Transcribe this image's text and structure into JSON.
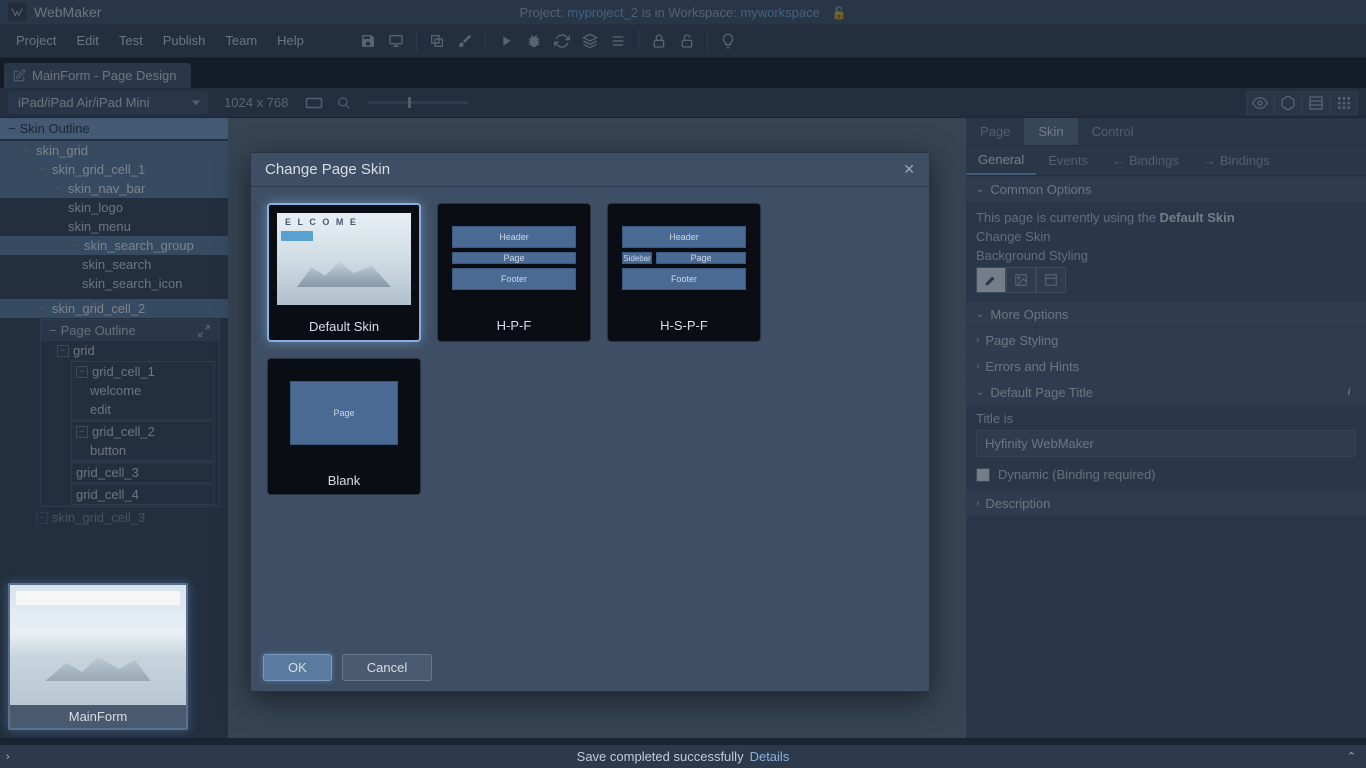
{
  "app": {
    "name": "WebMaker"
  },
  "project_line": {
    "prefix": "Project: ",
    "project": "myproject_2",
    "mid": " is in Workspace: ",
    "workspace": "myworkspace"
  },
  "menus": [
    "Project",
    "Edit",
    "Test",
    "Publish",
    "Team",
    "Help"
  ],
  "tab": {
    "label": "MainForm - Page Design"
  },
  "device": {
    "selected": "iPad/iPad Air/iPad Mini",
    "dimensions": "1024 x 768"
  },
  "outline": {
    "header": "Skin Outline",
    "tree": {
      "skin_grid": "skin_grid",
      "cell1": "skin_grid_cell_1",
      "nav": "skin_nav_bar",
      "logo": "skin_logo",
      "menu": "skin_menu",
      "searchg": "skin_search_group",
      "search": "skin_search",
      "searchi": "skin_search_icon",
      "cell2": "skin_grid_cell_2",
      "page_outline": "Page Outline",
      "grid": "grid",
      "gc1": "grid_cell_1",
      "welcome": "welcome",
      "edit": "edit",
      "gc2": "grid_cell_2",
      "button": "button",
      "gc3": "grid_cell_3",
      "gc4": "grid_cell_4",
      "cell3": "skin_grid_cell_3"
    }
  },
  "thumb": {
    "label": "MainForm"
  },
  "right": {
    "tabs1": {
      "page": "Page",
      "skin": "Skin",
      "control": "Control"
    },
    "tabs2": {
      "general": "General",
      "events": "Events",
      "bindings_in": "Bindings",
      "bindings_out": "Bindings"
    },
    "common": {
      "header": "Common Options",
      "line_pre": "This page is currently using the ",
      "line_skin": "Default Skin",
      "change": "Change Skin",
      "bgstyle": "Background Styling"
    },
    "more": "More Options",
    "pagestyle": "Page Styling",
    "errors": "Errors and Hints",
    "defaulttitle": "Default Page Title",
    "titleis": "Title is",
    "title_value": "Hyfinity WebMaker",
    "dynamic": "Dynamic (Binding required)",
    "description": "Description"
  },
  "dialog": {
    "title": "Change Page Skin",
    "skins": [
      {
        "name": "Default Skin",
        "type": "default"
      },
      {
        "name": "H-P-F",
        "type": "hpf"
      },
      {
        "name": "H-S-P-F",
        "type": "hspf"
      },
      {
        "name": "Blank",
        "type": "blank"
      }
    ],
    "ok": "OK",
    "cancel": "Cancel",
    "labels": {
      "header": "Header",
      "page": "Page",
      "footer": "Footer",
      "sidebar": "Sidebar"
    }
  },
  "status": {
    "msg": "Save completed successfully",
    "details": "Details"
  }
}
